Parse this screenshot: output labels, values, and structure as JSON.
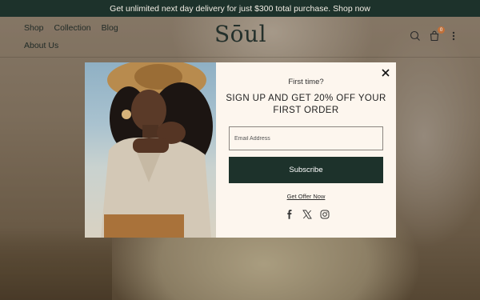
{
  "announcement": {
    "text": "Get unlimited next day delivery for just $300 total purchase. Shop now"
  },
  "header": {
    "nav": [
      "Shop",
      "Collection",
      "Blog"
    ],
    "nav_second": "About Us",
    "logo": "Sōul",
    "cart_count": "0",
    "icons": [
      "search-icon",
      "cart-icon",
      "more-vertical-icon"
    ]
  },
  "popup": {
    "eyebrow": "First time?",
    "headline": "SIGN UP AND GET 20% OFF YOUR FIRST ORDER",
    "email_placeholder": "Email Address",
    "subscribe_label": "Subscribe",
    "offer_link": "Get Offer Now",
    "socials": [
      "facebook-icon",
      "x-icon",
      "instagram-icon"
    ]
  },
  "colors": {
    "primary": "#1d322b",
    "popup_bg": "#fdf6ee",
    "badge": "#c0703a"
  }
}
